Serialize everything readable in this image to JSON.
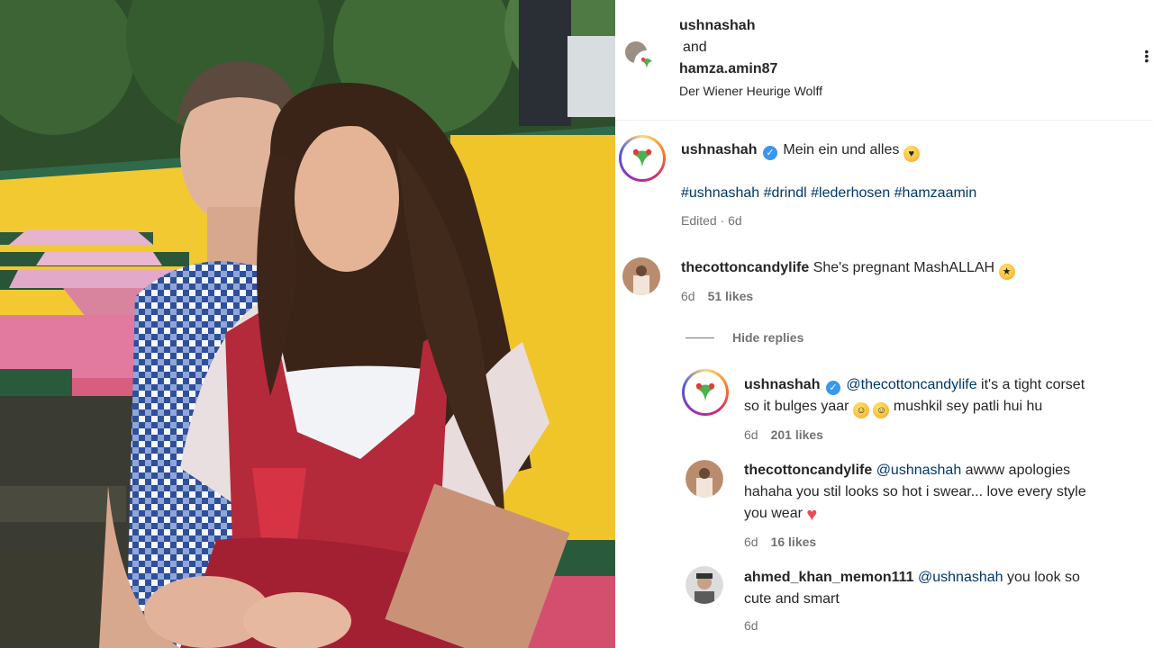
{
  "header": {
    "user1": "ushnashah",
    "and": "and",
    "user2": "hamza.amin87",
    "location": "Der Wiener Heurige Wolff"
  },
  "caption": {
    "user": "ushnashah",
    "text": "Mein ein und alles",
    "hashtags": [
      "#ushnashah",
      "#drindl",
      "#lederhosen",
      "#hamzaamin"
    ],
    "meta": "Edited · 6d"
  },
  "comment1": {
    "user": "thecottoncandylife",
    "text": "She's pregnant MashALLAH",
    "time": "6d",
    "likes": "51 likes"
  },
  "hide_replies": "Hide replies",
  "reply1": {
    "user": "ushnashah",
    "mention": "@thecottoncandylife",
    "text1": "it's a tight corset",
    "text2": "so it bulges yaar",
    "text3": "mushkil sey patli hui hu",
    "time": "6d",
    "likes": "201 likes"
  },
  "reply2": {
    "user": "thecottoncandylife",
    "mention": "@ushnashah",
    "text1": "awww apologies",
    "text2": "hahaha you stil looks so hot i swear... love every style",
    "text3": "you wear",
    "time": "6d",
    "likes": "16 likes"
  },
  "reply3": {
    "user": "ahmed_khan_memon111",
    "mention": "@ushnashah",
    "text1": "you look so",
    "text2": "cute and smart",
    "time": "6d"
  },
  "colors": {
    "verified": "#3897f0",
    "link": "#00376b",
    "secondary_text": "#737373",
    "wall_yellow": "#f2c931",
    "dirndl_red": "#b52a3a"
  }
}
